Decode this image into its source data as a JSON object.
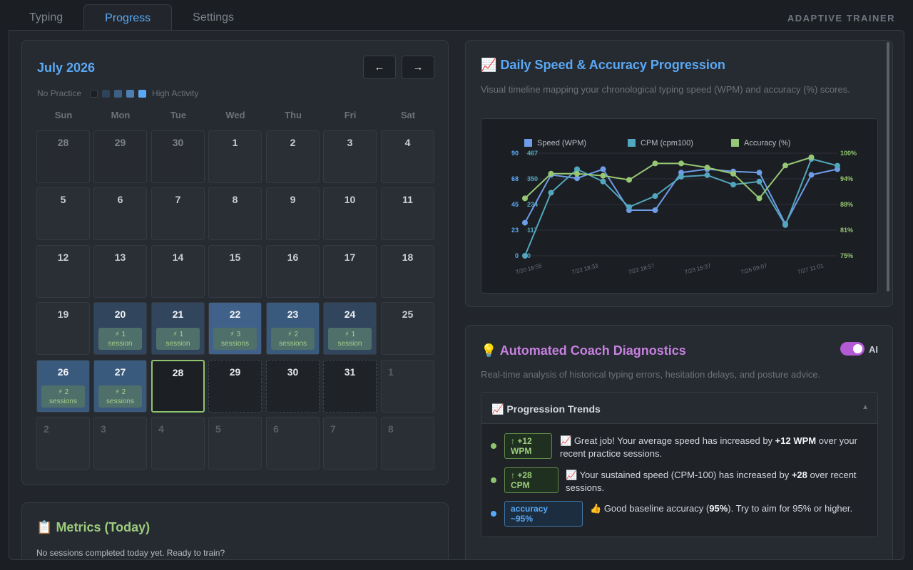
{
  "tabs": [
    "Typing",
    "Progress",
    "Settings"
  ],
  "brand": "ADAPTIVE TRAINER",
  "calendar": {
    "title": "July 2026",
    "prev": "←",
    "next": "→",
    "legend_low": "No Practice",
    "legend_high": "High Activity",
    "legend_colors": [
      "#1c1f24",
      "#2e4258",
      "#3e5f84",
      "#4d7fb5",
      "#5aa9f5"
    ],
    "weekdays": [
      "Sun",
      "Mon",
      "Tue",
      "Wed",
      "Thu",
      "Fri",
      "Sat"
    ],
    "days": [
      {
        "n": "28",
        "kind": "other"
      },
      {
        "n": "29",
        "kind": "other"
      },
      {
        "n": "30",
        "kind": "other"
      },
      {
        "n": "1",
        "kind": "empty"
      },
      {
        "n": "2",
        "kind": "empty"
      },
      {
        "n": "3",
        "kind": "empty"
      },
      {
        "n": "4",
        "kind": "empty"
      },
      {
        "n": "5",
        "kind": "empty"
      },
      {
        "n": "6",
        "kind": "empty"
      },
      {
        "n": "7",
        "kind": "empty"
      },
      {
        "n": "8",
        "kind": "empty"
      },
      {
        "n": "9",
        "kind": "empty"
      },
      {
        "n": "10",
        "kind": "empty"
      },
      {
        "n": "11",
        "kind": "empty"
      },
      {
        "n": "12",
        "kind": "empty"
      },
      {
        "n": "13",
        "kind": "empty"
      },
      {
        "n": "14",
        "kind": "empty"
      },
      {
        "n": "15",
        "kind": "empty"
      },
      {
        "n": "16",
        "kind": "empty"
      },
      {
        "n": "17",
        "kind": "empty"
      },
      {
        "n": "18",
        "kind": "empty"
      },
      {
        "n": "19",
        "kind": "empty"
      },
      {
        "n": "20",
        "kind": "low",
        "badge": [
          "⚡ 1",
          "session"
        ]
      },
      {
        "n": "21",
        "kind": "low",
        "badge": [
          "⚡ 1",
          "session"
        ]
      },
      {
        "n": "22",
        "kind": "high",
        "badge": [
          "⚡ 3",
          "sessions"
        ]
      },
      {
        "n": "23",
        "kind": "mid",
        "badge": [
          "⚡ 2",
          "sessions"
        ]
      },
      {
        "n": "24",
        "kind": "low",
        "badge": [
          "⚡ 1",
          "session"
        ]
      },
      {
        "n": "25",
        "kind": "empty"
      },
      {
        "n": "26",
        "kind": "mid",
        "badge": [
          "⚡ 2",
          "sessions"
        ]
      },
      {
        "n": "27",
        "kind": "mid",
        "badge": [
          "⚡ 2",
          "sessions"
        ]
      },
      {
        "n": "28",
        "kind": "today"
      },
      {
        "n": "29",
        "kind": "future"
      },
      {
        "n": "30",
        "kind": "future"
      },
      {
        "n": "31",
        "kind": "future"
      },
      {
        "n": "1",
        "kind": "nextm"
      },
      {
        "n": "2",
        "kind": "nextm"
      },
      {
        "n": "3",
        "kind": "nextm"
      },
      {
        "n": "4",
        "kind": "nextm"
      },
      {
        "n": "5",
        "kind": "nextm"
      },
      {
        "n": "6",
        "kind": "nextm"
      },
      {
        "n": "7",
        "kind": "nextm"
      },
      {
        "n": "8",
        "kind": "nextm"
      }
    ],
    "level_colors": {
      "low": "#31465c",
      "mid": "#3a5a7d",
      "high": "#40628a"
    }
  },
  "metrics": {
    "icon": "📋",
    "title": "Metrics (Today)",
    "subtitle": "No sessions completed today yet. Ready to train?"
  },
  "chart_card": {
    "icon": "📈",
    "title": "Daily Speed & Accuracy Progression",
    "subtitle": "Visual timeline mapping your chronological typing speed (WPM) and accuracy (%) scores."
  },
  "chart_data": {
    "type": "line",
    "x_tick_labels": [
      "7/20 18:55",
      "7/22 18:33",
      "7/22 18:57",
      "7/23 15:37",
      "7/26 09:07",
      "7/27 11:01"
    ],
    "series": [
      {
        "name": "Speed (WPM)",
        "color": "#6f9ce8",
        "axis": "left",
        "values": [
          29,
          71,
          68,
          76,
          40,
          40,
          73,
          76,
          74,
          73,
          28,
          71,
          76
        ]
      },
      {
        "name": "CPM (cpm100)",
        "color": "#52a7bf",
        "axis": "cpm",
        "values": [
          0,
          287,
          394,
          338,
          222,
          272,
          360,
          367,
          324,
          338,
          140,
          441,
          410
        ]
      },
      {
        "name": "Accuracy (%)",
        "color": "#96c774",
        "axis": "right",
        "values": [
          89,
          95,
          95,
          94.5,
          93.5,
          97.5,
          97.5,
          96.5,
          95,
          89,
          97,
          99
        ]
      }
    ],
    "y_left": {
      "ticks": [
        "90",
        "68",
        "45",
        "23",
        "0"
      ],
      "min": 0,
      "max": 90
    },
    "y_cpm": {
      "ticks": [
        "467",
        "350",
        "234",
        "117",
        "0"
      ],
      "min": 0,
      "max": 467
    },
    "y_right": {
      "ticks": [
        "100%",
        "94%",
        "88%",
        "81%",
        "75%"
      ],
      "min": 75,
      "max": 100
    },
    "grid": true,
    "legend": "top"
  },
  "coach": {
    "icon": "💡",
    "title": "Automated Coach Diagnostics",
    "toggle_label": "AI",
    "subtitle": "Real-time analysis of historical typing errors, hesitation delays, and posture advice.",
    "panel_icon": "📈",
    "panel_title": "Progression Trends",
    "caret": "▲",
    "trends": [
      {
        "dot": "#8fc46e",
        "badge": [
          "↑ +12",
          "WPM"
        ],
        "badge_style": "green",
        "icon": "📈",
        "pre": "Great job! Your average speed has increased by ",
        "bold": "+12 WPM",
        "post": " over your recent practice sessions."
      },
      {
        "dot": "#8fc46e",
        "badge": [
          "↑ +28",
          "CPM"
        ],
        "badge_style": "green",
        "icon": "📈",
        "pre": "Your sustained speed (CPM-100) has increased by ",
        "bold": "+28",
        "post": " over recent sessions."
      },
      {
        "dot": "#5aa9f5",
        "badge": [
          "accuracy",
          "~95%"
        ],
        "badge_style": "blue",
        "icon": "👍",
        "pre": "Good baseline accuracy (",
        "bold": "95%",
        "post": "). Try to aim for 95% or higher."
      }
    ]
  }
}
